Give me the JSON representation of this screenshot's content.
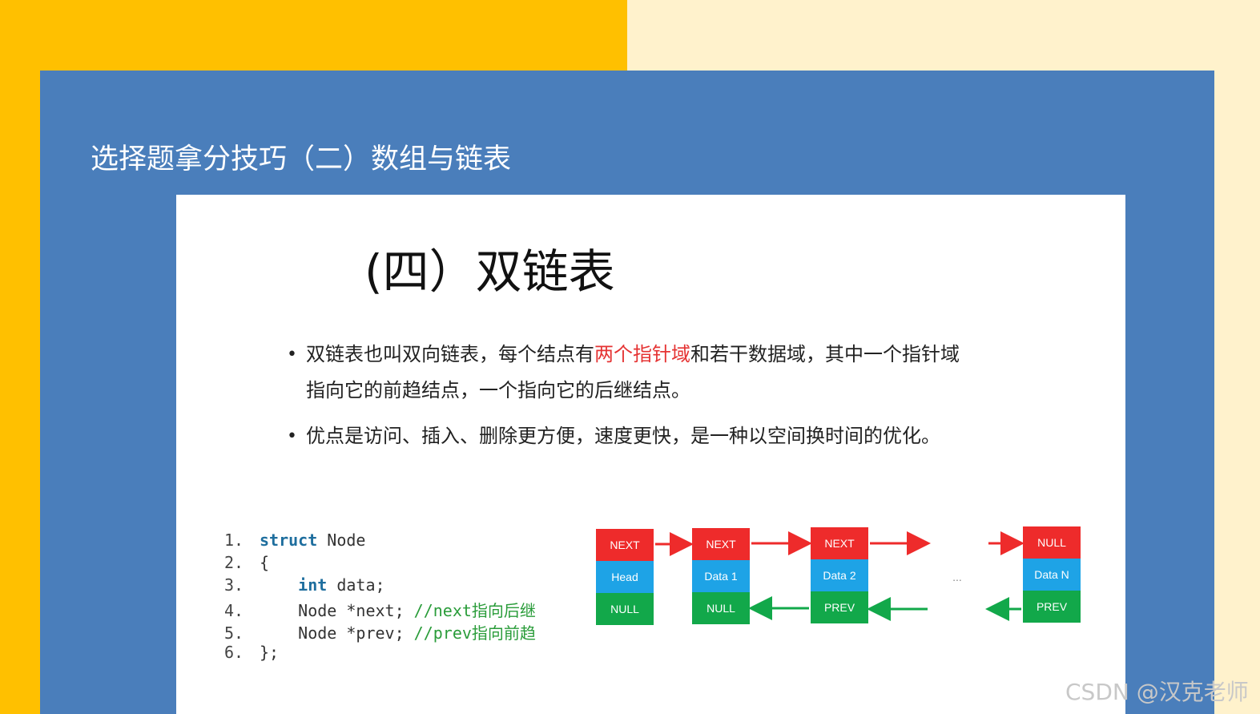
{
  "slide": {
    "title": "选择题拿分技巧（二）数组与链表"
  },
  "card": {
    "heading": "(四）双链表",
    "bullets": [
      {
        "line1_before": "双链表也叫双向链表，每个结点有",
        "line1_highlight": "两个指针域",
        "line1_after": "和若干数据域，其中一个指针域",
        "line2": "指向它的前趋结点，一个指向它的后继结点。"
      },
      {
        "line1": "优点是访问、插入、删除更方便，速度更快，是一种以空间换时间的优化。"
      }
    ],
    "code": [
      {
        "num": "1.",
        "kw": "struct",
        "rest": " Node",
        "comment": ""
      },
      {
        "num": "2.",
        "kw": "",
        "rest": "{",
        "comment": ""
      },
      {
        "num": "3.",
        "kw": "    int",
        "rest": " data;",
        "comment": ""
      },
      {
        "num": "4.",
        "kw": "",
        "rest": "    Node *next; ",
        "comment": "//next指向后继"
      },
      {
        "num": "5.",
        "kw": "",
        "rest": "    Node *prev; ",
        "comment": "//prev指向前趋"
      },
      {
        "num": "6.",
        "kw": "",
        "rest": "};",
        "comment": ""
      }
    ],
    "diagram": {
      "nodes": [
        {
          "top": "NEXT",
          "mid": "Head",
          "bottom": "NULL"
        },
        {
          "top": "NEXT",
          "mid": "Data 1",
          "bottom": "NULL"
        },
        {
          "top": "NEXT",
          "mid": "Data 2",
          "bottom": "PREV"
        },
        {
          "top": "NULL",
          "mid": "Data N",
          "bottom": "PREV"
        }
      ],
      "ellipsis": "...",
      "colors": {
        "next": "#ee2b2b",
        "data": "#1ea3e6",
        "prev": "#12a84a",
        "arrow_next": "#ee2b2b",
        "arrow_prev": "#12a84a"
      }
    }
  },
  "watermark": "CSDN @汉克老师"
}
